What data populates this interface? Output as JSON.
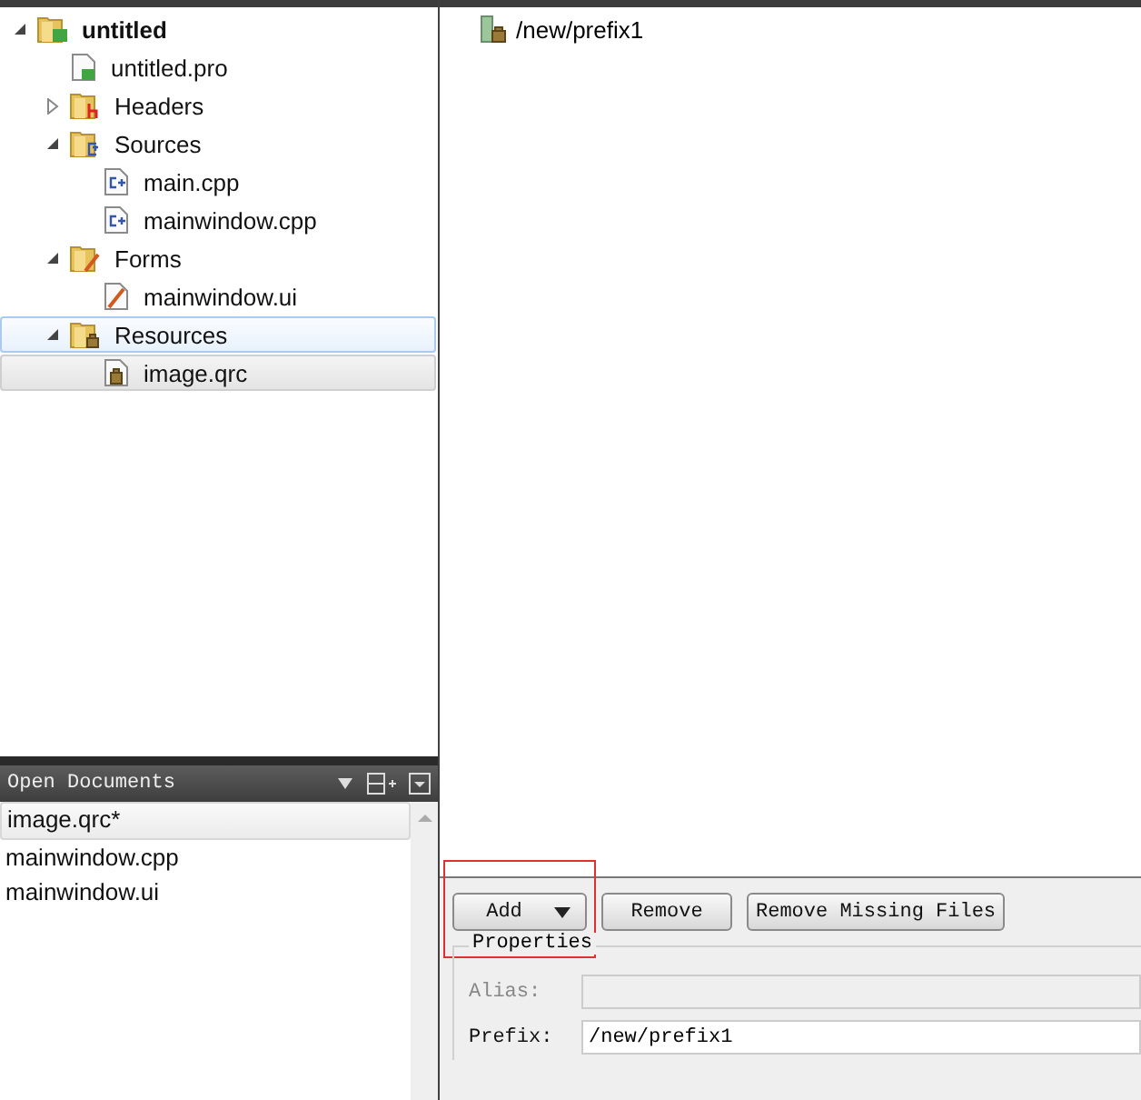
{
  "project_tree": [
    {
      "label": "untitled",
      "kind": "project",
      "expanded": true,
      "selected": false,
      "hovered": false,
      "children": [
        {
          "label": "untitled.pro",
          "kind": "project-file",
          "selected": false,
          "hovered": false
        },
        {
          "label": "Headers",
          "kind": "header-folder",
          "expanded": false,
          "selected": false,
          "hovered": false
        },
        {
          "label": "Sources",
          "kind": "source-folder",
          "expanded": true,
          "selected": false,
          "hovered": false,
          "children": [
            {
              "label": "main.cpp",
              "kind": "source-file",
              "selected": false,
              "hovered": false
            },
            {
              "label": "mainwindow.cpp",
              "kind": "source-file",
              "selected": false,
              "hovered": false
            }
          ]
        },
        {
          "label": "Forms",
          "kind": "form-folder",
          "expanded": true,
          "selected": false,
          "hovered": false,
          "children": [
            {
              "label": "mainwindow.ui",
              "kind": "form-file",
              "selected": false,
              "hovered": false
            }
          ]
        },
        {
          "label": "Resources",
          "kind": "resource-folder",
          "expanded": true,
          "selected": true,
          "hovered": false,
          "children": [
            {
              "label": "image.qrc",
              "kind": "resource-file",
              "selected": false,
              "hovered": true
            }
          ]
        }
      ]
    }
  ],
  "open_documents": {
    "title": "Open Documents",
    "items": [
      {
        "label": "image.qrc*",
        "selected": true
      },
      {
        "label": "mainwindow.cpp",
        "selected": false
      },
      {
        "label": "mainwindow.ui",
        "selected": false
      }
    ]
  },
  "resource_tree": [
    {
      "label": "/new/prefix1",
      "selected": false
    }
  ],
  "buttons": [
    {
      "label": "Add",
      "kind": "dropdown",
      "marked": true
    },
    {
      "label": "Remove",
      "kind": "plain",
      "marked": false
    },
    {
      "label": "Remove Missing Files",
      "kind": "plain",
      "marked": false
    }
  ],
  "properties": {
    "title": "Properties",
    "fields": [
      {
        "label": "Alias:",
        "disabled": true
      },
      {
        "label": "Prefix:",
        "value": "/new/prefix1",
        "disabled": false
      }
    ]
  }
}
